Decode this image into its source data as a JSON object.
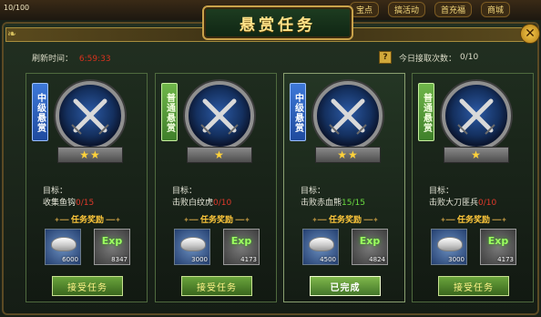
{
  "hud": {
    "hp_text": "10/100",
    "tabs": [
      "宝点",
      "搞活动",
      "首充福",
      "商城"
    ]
  },
  "window": {
    "title": "悬赏任务",
    "close_symbol": "✕"
  },
  "refresh": {
    "label": "刷新时间：",
    "time": "6:59:33"
  },
  "accepted": {
    "help_symbol": "?",
    "label": "今日接取次数：",
    "count": "0/10"
  },
  "reward_header": "任务奖励",
  "cards": [
    {
      "ribbon": "中级悬赏",
      "ribbon_color": "blue",
      "stars": "★★",
      "goal_label": "目标：",
      "goal_text": "收集鱼钩",
      "progress": "0/15",
      "progress_state": "incomplete",
      "silver": "6000",
      "exp": "8347",
      "button": "接受任务",
      "status": "available"
    },
    {
      "ribbon": "普通悬赏",
      "ribbon_color": "green",
      "stars": "★",
      "goal_label": "目标：",
      "goal_text": "击败白纹虎",
      "progress": "0/10",
      "progress_state": "incomplete",
      "silver": "3000",
      "exp": "4173",
      "button": "接受任务",
      "status": "available"
    },
    {
      "ribbon": "中级悬赏",
      "ribbon_color": "blue",
      "stars": "★★",
      "goal_label": "目标：",
      "goal_text": "击败赤血熊",
      "progress": "15/15",
      "progress_state": "complete",
      "silver": "4500",
      "exp": "4824",
      "button": "已完成",
      "status": "completed"
    },
    {
      "ribbon": "普通悬赏",
      "ribbon_color": "green",
      "stars": "★",
      "goal_label": "目标：",
      "goal_text": "击败大刀匪兵",
      "progress": "0/10",
      "progress_state": "incomplete",
      "silver": "3000",
      "exp": "4173",
      "button": "接受任务",
      "status": "available"
    }
  ],
  "exp_icon_text": "Exp",
  "colors": {
    "accent_gold": "#ffe38a",
    "progress_red": "#e0392b",
    "progress_green": "#6bdd40"
  }
}
